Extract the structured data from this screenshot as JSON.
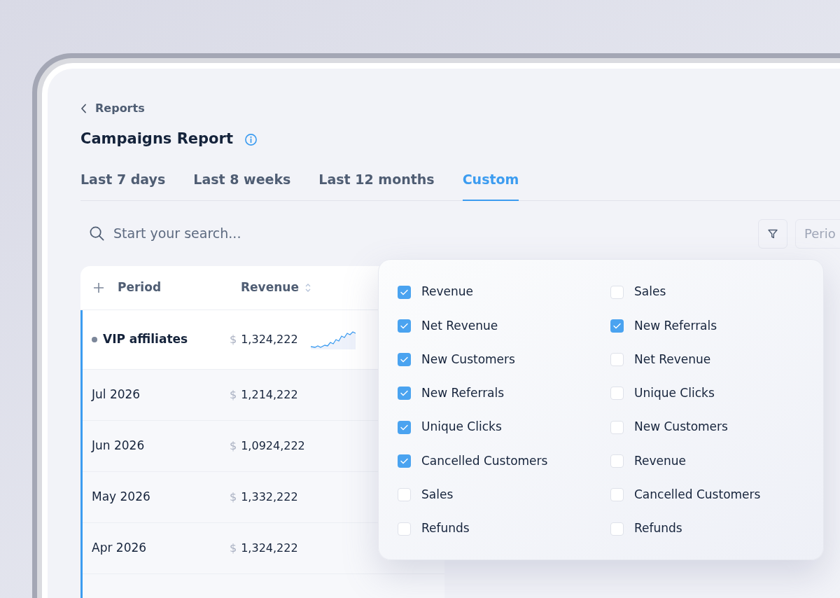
{
  "breadcrumb": {
    "label": "Reports"
  },
  "title": "Campaigns Report",
  "tabs": [
    {
      "label": "Last 7 days",
      "selected": false
    },
    {
      "label": "Last 8 weeks",
      "selected": false
    },
    {
      "label": "Last 12 months",
      "selected": false
    },
    {
      "label": "Custom",
      "selected": true
    }
  ],
  "search": {
    "placeholder": "Start your search..."
  },
  "toolbar": {
    "period_button": "Perio"
  },
  "table": {
    "columns": [
      "Period",
      "Revenue"
    ],
    "rows": [
      {
        "kind": "group",
        "period": "VIP affiliates",
        "currency": "$",
        "revenue": "1,324,222"
      },
      {
        "kind": "month",
        "period": "Jul 2026",
        "currency": "$",
        "revenue": "1,214,222"
      },
      {
        "kind": "month",
        "period": "Jun 2026",
        "currency": "$",
        "revenue": "1,0924,222"
      },
      {
        "kind": "month",
        "period": "May 2026",
        "currency": "$",
        "revenue": "1,332,222"
      },
      {
        "kind": "month",
        "period": "Apr 2026",
        "currency": "$",
        "revenue": "1,324,222"
      }
    ]
  },
  "column_menu": {
    "columns": [
      [
        {
          "label": "Revenue",
          "checked": true
        },
        {
          "label": "Net Revenue",
          "checked": true
        },
        {
          "label": "New Customers",
          "checked": true
        },
        {
          "label": "New Referrals",
          "checked": true
        },
        {
          "label": "Unique Clicks",
          "checked": true
        },
        {
          "label": "Cancelled Customers",
          "checked": true
        },
        {
          "label": "Sales",
          "checked": false
        },
        {
          "label": "Refunds",
          "checked": false
        }
      ],
      [
        {
          "label": "Sales",
          "checked": false
        },
        {
          "label": "New Referrals",
          "checked": true
        },
        {
          "label": "Net Revenue",
          "checked": false
        },
        {
          "label": "Unique Clicks",
          "checked": false
        },
        {
          "label": "New Customers",
          "checked": false
        },
        {
          "label": "Revenue",
          "checked": false
        },
        {
          "label": "Cancelled Customers",
          "checked": false
        },
        {
          "label": "Refunds",
          "checked": false
        }
      ]
    ]
  }
}
